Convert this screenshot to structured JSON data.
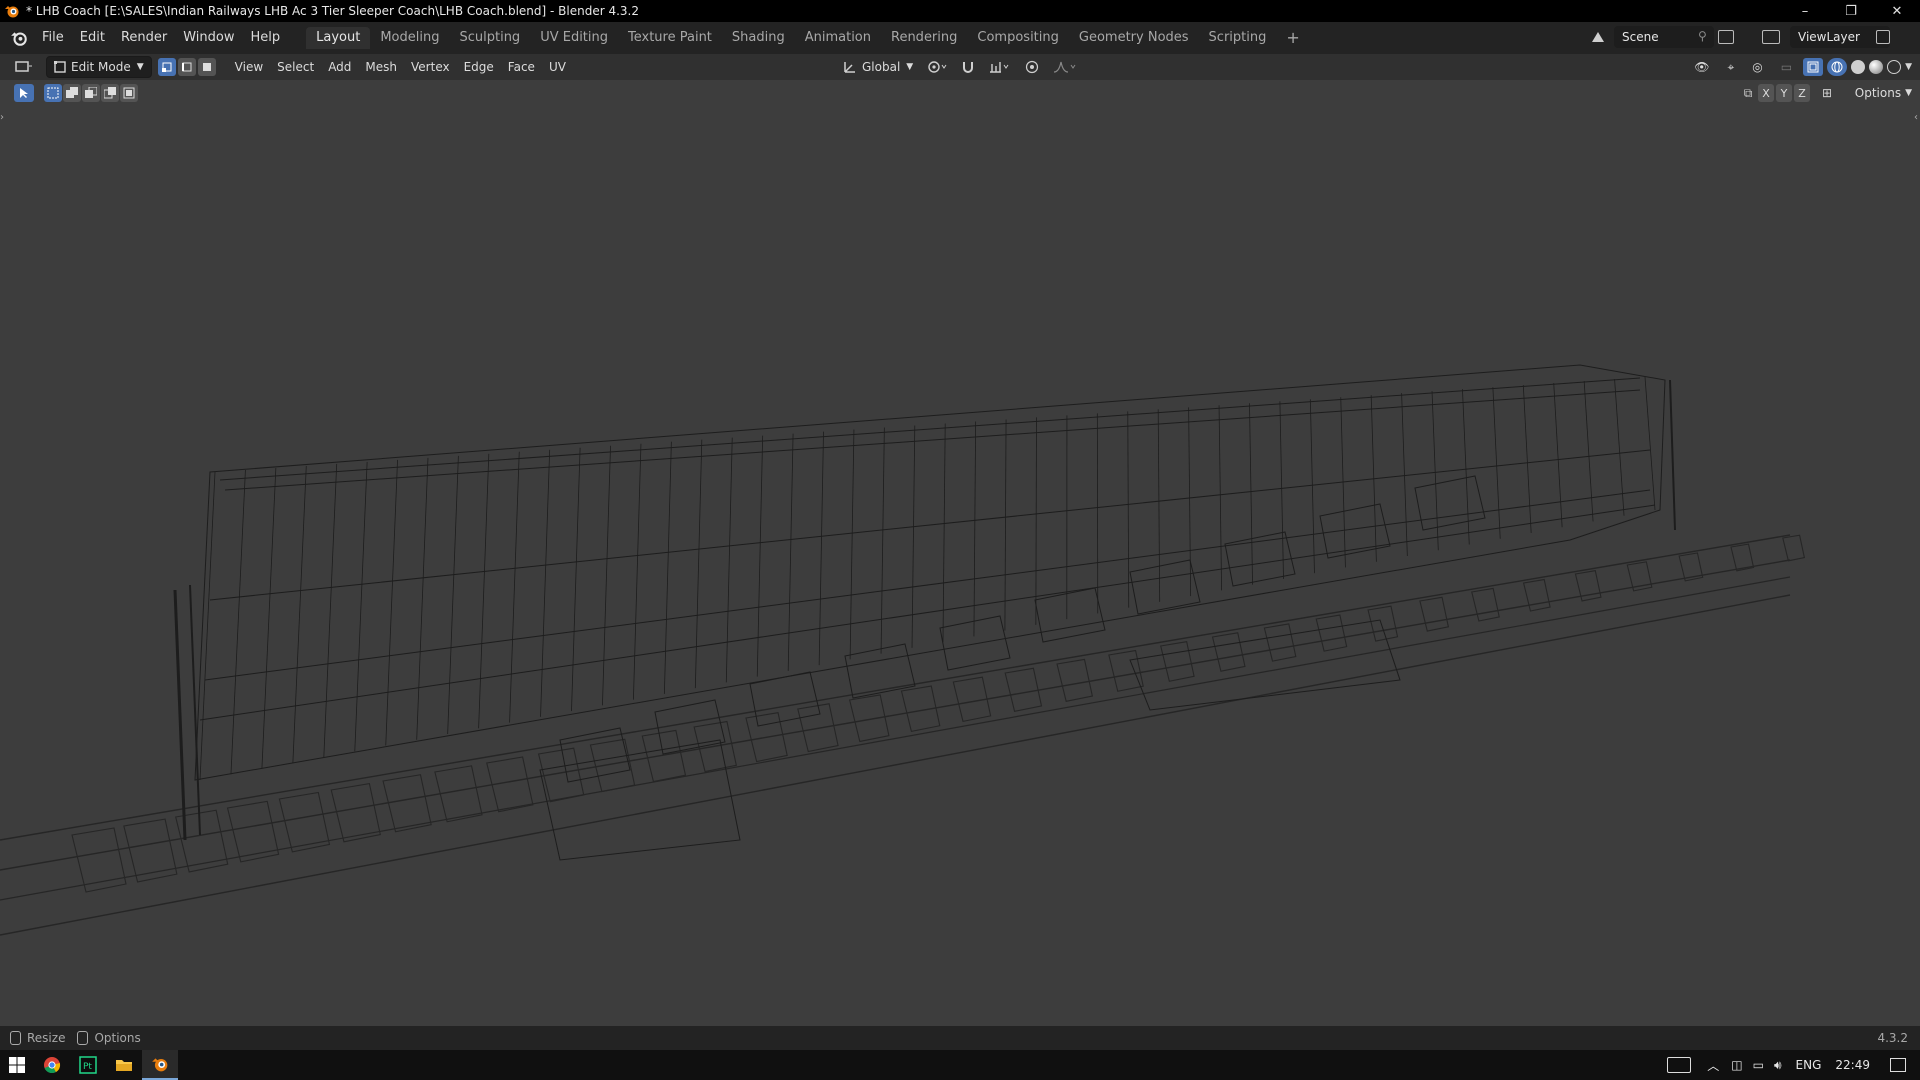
{
  "window": {
    "title": "* LHB Coach [E:\\SALES\\Indian Railways LHB Ac 3 Tier Sleeper Coach\\LHB Coach.blend] - Blender 4.3.2",
    "minimize": "–",
    "maximize": "❐",
    "close": "✕"
  },
  "menu": {
    "items": [
      "File",
      "Edit",
      "Render",
      "Window",
      "Help"
    ]
  },
  "workspaces": {
    "tabs": [
      "Layout",
      "Modeling",
      "Sculpting",
      "UV Editing",
      "Texture Paint",
      "Shading",
      "Animation",
      "Rendering",
      "Compositing",
      "Geometry Nodes",
      "Scripting"
    ],
    "active": "Layout",
    "add": "+"
  },
  "scene": {
    "name": "Scene"
  },
  "view_layer": {
    "name": "ViewLayer"
  },
  "header": {
    "mode": "Edit Mode",
    "menus": [
      "View",
      "Select",
      "Add",
      "Mesh",
      "Vertex",
      "Edge",
      "Face",
      "UV"
    ],
    "transform_orientation": "Global",
    "options": "Options",
    "axes": [
      "X",
      "Y",
      "Z"
    ]
  },
  "statusbar": {
    "resize": "Resize",
    "options": "Options",
    "version": "4.3.2"
  },
  "taskbar": {
    "lang": "ENG",
    "time": "22:49"
  },
  "colors": {
    "accent": "#4772b3",
    "viewport_bg": "#3d3d3d",
    "wire": "#1c1c1c"
  }
}
